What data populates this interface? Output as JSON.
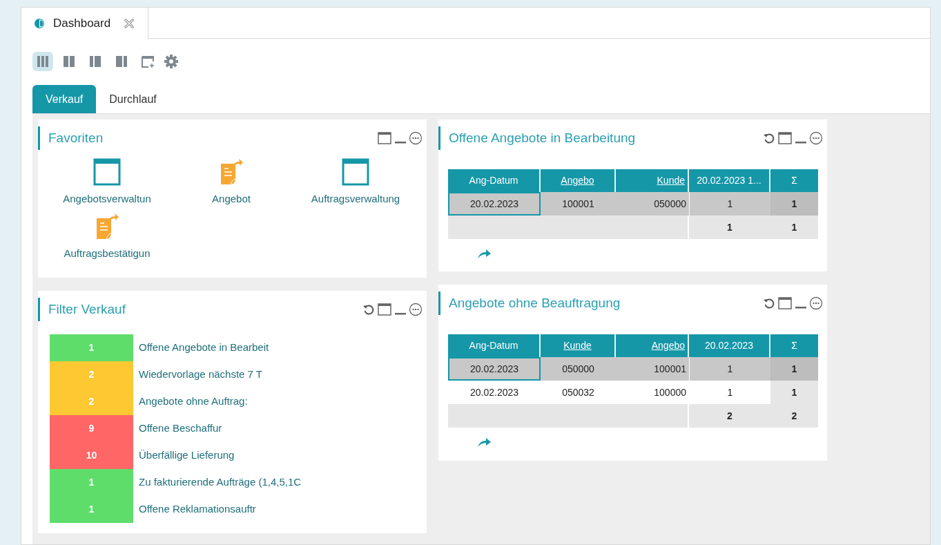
{
  "editor_tab": {
    "title": "Dashboard"
  },
  "layout_buttons": [
    {
      "kind": "three",
      "selected": true
    },
    {
      "kind": "two",
      "selected": false
    },
    {
      "kind": "right-wide",
      "selected": false
    },
    {
      "kind": "left-wide",
      "selected": false
    }
  ],
  "tabs": [
    {
      "label": "Verkauf",
      "selected": true
    },
    {
      "label": "Durchlauf",
      "selected": false
    }
  ],
  "favorites": {
    "title": "Favoriten",
    "refresh": false,
    "items": [
      {
        "label": "Angebotsverwaltun",
        "kind": "window"
      },
      {
        "label": "Angebot",
        "kind": "document"
      },
      {
        "label": "Auftragsverwaltung",
        "kind": "window"
      },
      {
        "label": "Auftragsbestätigun",
        "kind": "document"
      }
    ]
  },
  "filter": {
    "title": "Filter Verkauf",
    "refresh": true,
    "items": [
      {
        "count": "1",
        "label": "Offene Angebote in Bearbeit",
        "color": "#5fdd6b"
      },
      {
        "count": "2",
        "label": "Wiedervorlage nächste 7 T",
        "color": "#fec832"
      },
      {
        "count": "2",
        "label": "Angebote ohne Auftrag:",
        "color": "#fec832"
      },
      {
        "count": "9",
        "label": "Offene Beschaffur",
        "color": "#ff6666"
      },
      {
        "count": "10",
        "label": "Überfällige Lieferung",
        "color": "#ff6666"
      },
      {
        "count": "1",
        "label": "Zu fakturierende Aufträge (1,4,5,1C",
        "color": "#5fdd6b"
      },
      {
        "count": "1",
        "label": "Offene Reklamationsauftr",
        "color": "#5fdd6b"
      }
    ]
  },
  "tables": [
    {
      "title": "Offene Angebote in Bearbeitung",
      "refresh": true,
      "columns": [
        {
          "label": "Ang-Datum",
          "underlined": false
        },
        {
          "label": "Angebo",
          "underlined": true
        },
        {
          "label": "Kunde",
          "underlined": true
        },
        {
          "label": "20.02.2023 1...",
          "underlined": false
        },
        {
          "label": "Σ",
          "underlined": false
        }
      ],
      "rows": [
        {
          "cells": [
            "20.02.2023",
            "100001",
            "050000",
            "1",
            "1"
          ],
          "selected": true
        }
      ],
      "totals": [
        "1",
        "1"
      ]
    },
    {
      "title": "Angebote ohne Beauftragung",
      "refresh": true,
      "columns": [
        {
          "label": "Ang-Datum",
          "underlined": false
        },
        {
          "label": "Kunde",
          "underlined": true
        },
        {
          "label": "Angebo",
          "underlined": true
        },
        {
          "label": "20.02.2023",
          "underlined": false
        },
        {
          "label": "Σ",
          "underlined": false
        }
      ],
      "rows": [
        {
          "cells": [
            "20.02.2023",
            "050000",
            "100001",
            "1",
            "1"
          ],
          "selected": true
        },
        {
          "cells": [
            "20.02.2023",
            "050032",
            "100000",
            "1",
            "1"
          ],
          "selected": false
        }
      ],
      "totals": [
        "2",
        "2"
      ]
    }
  ]
}
